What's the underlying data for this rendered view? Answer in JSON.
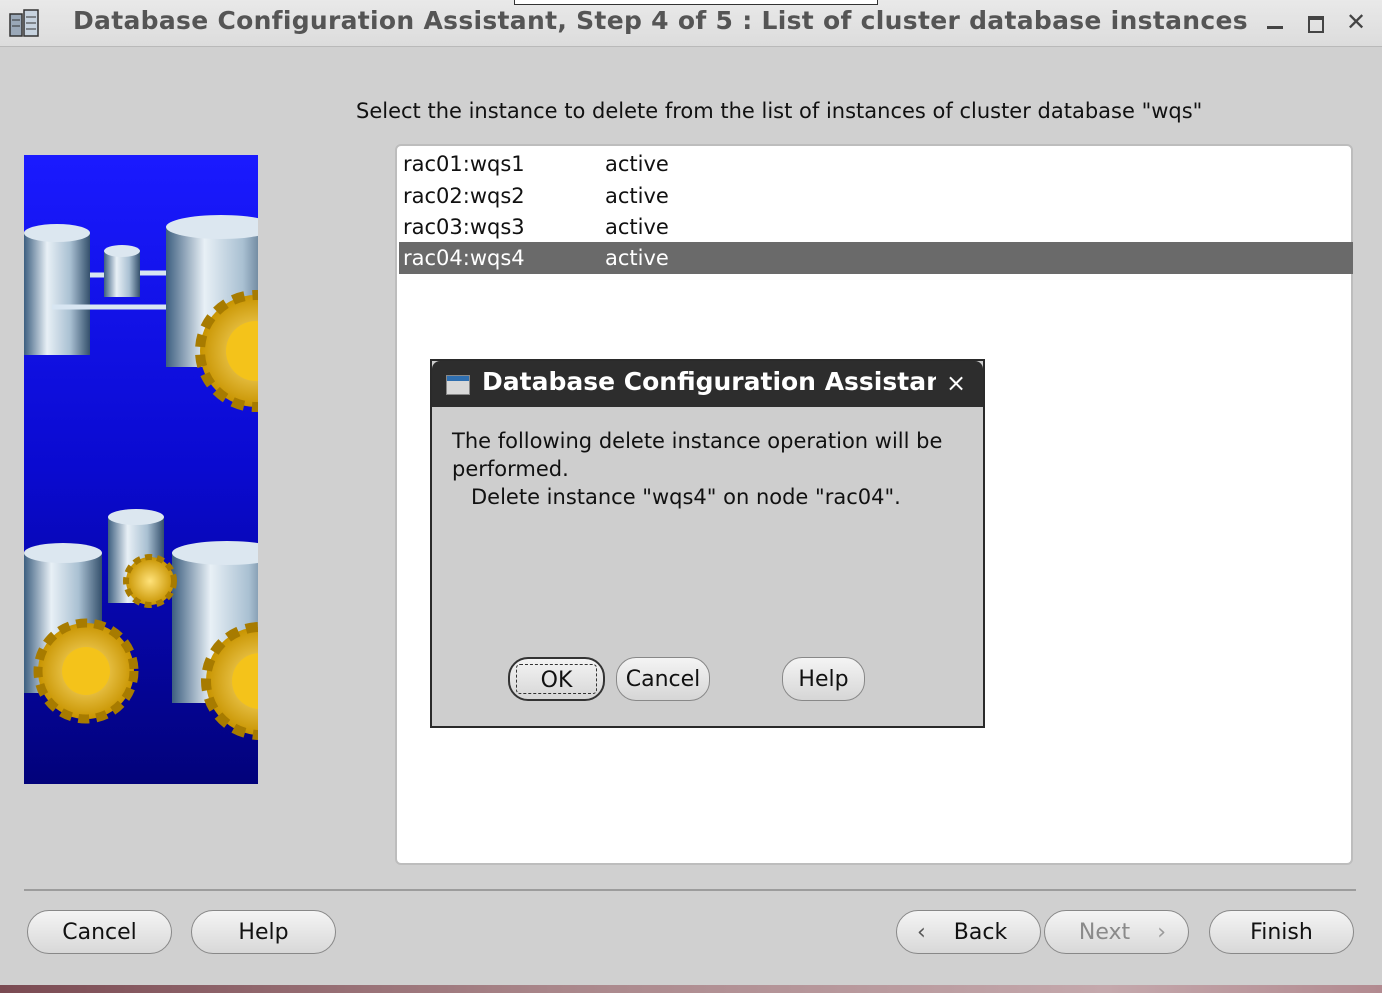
{
  "window": {
    "title": "Database Configuration Assistant, Step 4 of 5 : List of cluster database instances",
    "icon": "database-app-icon",
    "controls": [
      "minimize-icon",
      "maximize-icon",
      "close-icon"
    ]
  },
  "main": {
    "prompt": "Select the instance to delete from the list of instances of cluster database \"wqs\"",
    "instances": [
      {
        "name": "rac01:wqs1",
        "status": "active",
        "selected": false
      },
      {
        "name": "rac02:wqs2",
        "status": "active",
        "selected": false
      },
      {
        "name": "rac03:wqs3",
        "status": "active",
        "selected": false
      },
      {
        "name": "rac04:wqs4",
        "status": "active",
        "selected": true
      }
    ]
  },
  "footer": {
    "cancel_label": "Cancel",
    "help_label": "Help",
    "back_label": "Back",
    "next_label": "Next",
    "finish_label": "Finish"
  },
  "dialog": {
    "title": "Database Configuration Assistant",
    "message_line1": "The following delete instance operation will be",
    "message_line2": "performed.",
    "message_line3": "Delete instance \"wqs4\" on node \"rac04\".",
    "ok_label": "OK",
    "cancel_label": "Cancel",
    "help_label": "Help"
  },
  "colors": {
    "selection": "#6a6a6a",
    "panel_background": "#d0d0d0",
    "dialog_titlebar": "#2d2d2d",
    "image_background": "#1010d8"
  }
}
